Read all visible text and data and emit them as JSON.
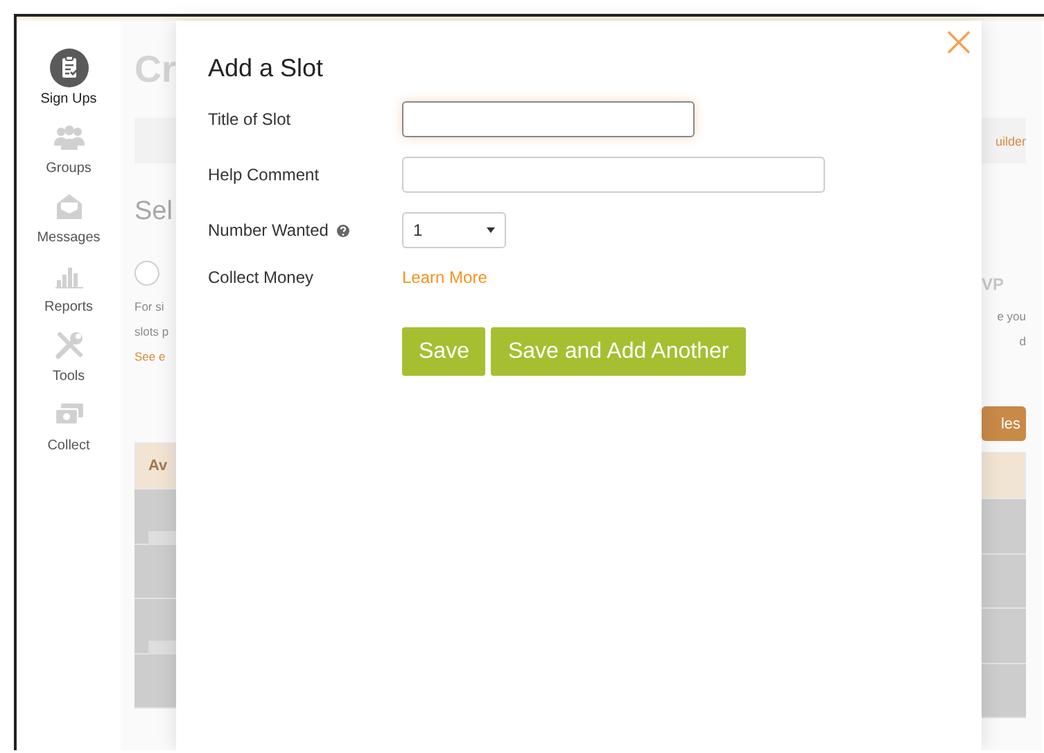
{
  "sidebar": {
    "items": [
      {
        "label": "Sign Ups",
        "selected": true
      },
      {
        "label": "Groups",
        "selected": false
      },
      {
        "label": "Messages",
        "selected": false
      },
      {
        "label": "Reports",
        "selected": false
      },
      {
        "label": "Tools",
        "selected": false
      },
      {
        "label": "Collect",
        "selected": false
      }
    ]
  },
  "background_page": {
    "title_fragment": "Cr",
    "panel_link_fragment": "uilder",
    "section_title_fragment": "Sel",
    "option_selected": false,
    "option_title_fragment": "VP",
    "left_text_lines": [
      "For si",
      "slots p"
    ],
    "left_link_fragment": "See e",
    "right_text_lines": [
      "e you",
      "d"
    ],
    "button_fragment": "les",
    "table_header_fragment": "Av"
  },
  "dialog": {
    "title": "Add a Slot",
    "fields": [
      {
        "kind": "text",
        "label": "Title of Slot",
        "focused": true
      },
      {
        "kind": "text",
        "label": "Help Comment",
        "focused": false
      },
      {
        "kind": "select",
        "label": "Number Wanted",
        "help": true,
        "value": "1"
      },
      {
        "kind": "link",
        "label": "Collect Money",
        "link": "Learn More"
      }
    ],
    "buttons": [
      "Save",
      "Save and Add Another"
    ]
  }
}
